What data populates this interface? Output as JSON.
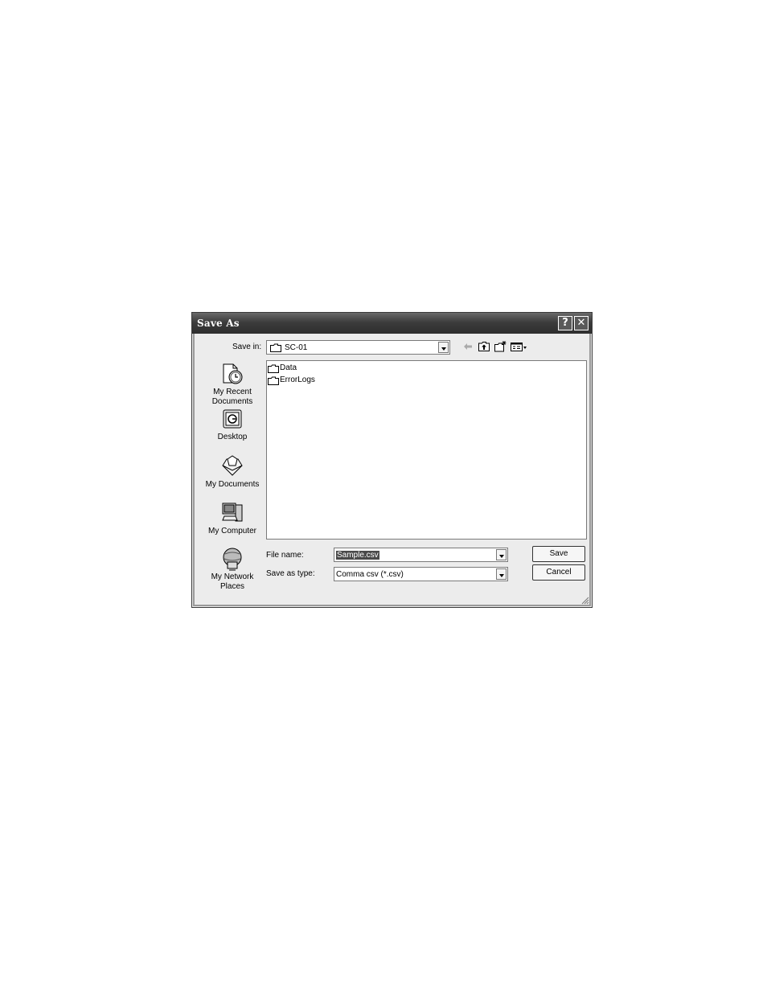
{
  "dialog": {
    "title": "Save As",
    "help_icon": "?",
    "close_icon": "✕"
  },
  "save_in": {
    "label": "Save in:",
    "value": "SC-01"
  },
  "toolbar": {
    "icons": [
      "back-arrow-icon",
      "up-one-level-icon",
      "new-folder-icon",
      "view-menu-icon"
    ]
  },
  "places": [
    {
      "label": "My Recent Documents",
      "icon": "recent-documents-icon"
    },
    {
      "label": "Desktop",
      "icon": "desktop-icon"
    },
    {
      "label": "My Documents",
      "icon": "my-documents-icon"
    },
    {
      "label": "My Computer",
      "icon": "my-computer-icon"
    },
    {
      "label": "My Network Places",
      "icon": "network-places-icon"
    }
  ],
  "files": [
    {
      "name": "Data"
    },
    {
      "name": "ErrorLogs"
    }
  ],
  "file_name": {
    "label": "File name:",
    "value": "Sample.csv"
  },
  "save_as_type": {
    "label": "Save as type:",
    "value": "Comma csv (*.csv)"
  },
  "buttons": {
    "save": "Save",
    "cancel": "Cancel"
  }
}
